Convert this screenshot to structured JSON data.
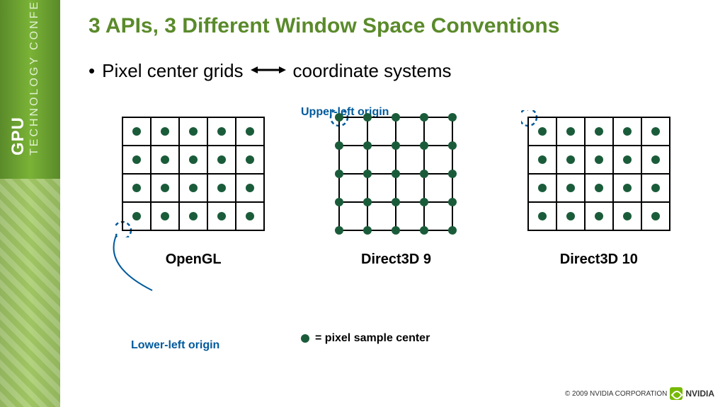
{
  "sidebar": {
    "main": "GPU",
    "sub": "TECHNOLOGY\nCONFERENCE"
  },
  "title": "3 APIs, 3 Different Window Space Conventions",
  "bullet": {
    "left": "Pixel center grids",
    "right": "coordinate systems"
  },
  "annotations": {
    "upper_left": "Upper-left origin",
    "lower_left": "Lower-left origin"
  },
  "grids": {
    "opengl": "OpenGL",
    "d3d9": "Direct3D 9",
    "d3d10": "Direct3D 10"
  },
  "legend": "= pixel sample center",
  "footer": "© 2009 NVIDIA CORPORATION",
  "logo": "NVIDIA"
}
